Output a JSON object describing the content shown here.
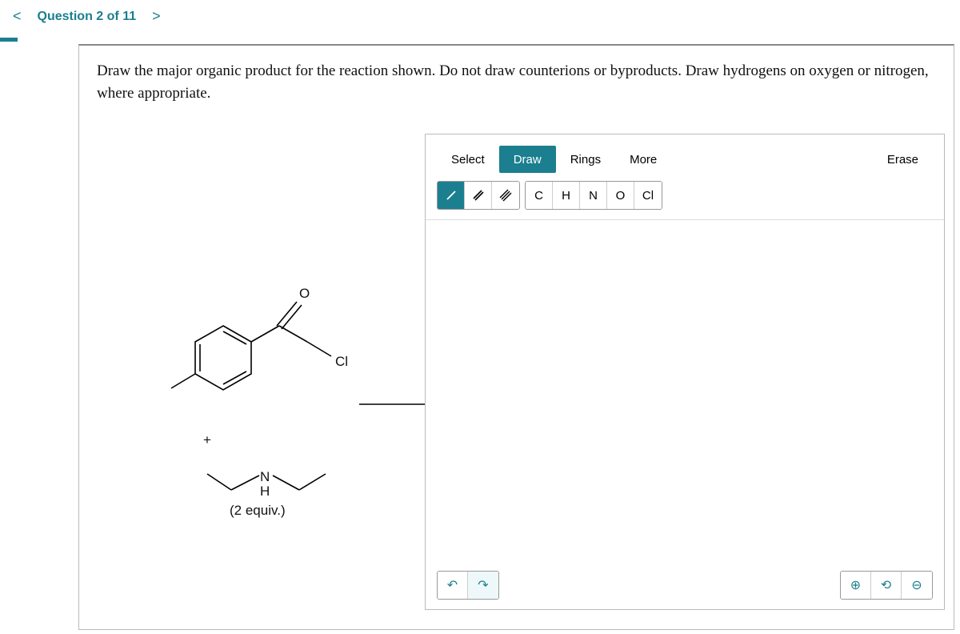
{
  "nav": {
    "prev": "<",
    "next": ">",
    "question_label": "Question 2 of 11"
  },
  "prompt": "Draw the major organic product for the reaction shown. Do not draw counterions or byproducts. Draw hydrogens on oxygen or nitrogen, where appropriate.",
  "reaction": {
    "top_atom_O": "O",
    "right_atom_Cl": "Cl",
    "plus": "+",
    "amine_N": "N",
    "amine_H": "H",
    "equiv_note": "(2 equiv.)"
  },
  "toolbar": {
    "modes": {
      "select": "Select",
      "draw": "Draw",
      "rings": "Rings",
      "more": "More",
      "erase": "Erase"
    },
    "active_mode": "draw",
    "bonds": {
      "single": "/",
      "double": "//",
      "triple": "///"
    },
    "active_bond": "single",
    "elements": [
      "C",
      "H",
      "N",
      "O",
      "Cl"
    ]
  },
  "icons": {
    "undo": "↶",
    "redo": "↷",
    "zoom_in": "⊕",
    "zoom_reset": "⟲",
    "zoom_out": "⊖"
  }
}
